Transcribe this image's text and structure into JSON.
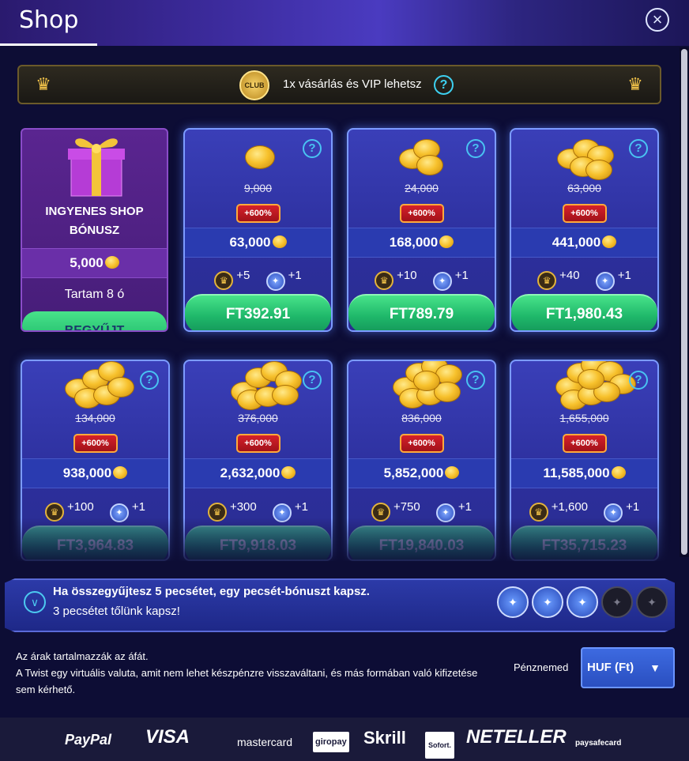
{
  "header": {
    "title": "Shop",
    "close_icon": "×"
  },
  "vip_banner": {
    "text": "1x vásárlás és VIP lehetsz",
    "club_label": "CLUB",
    "help": "?"
  },
  "free_card": {
    "title": "INGYENES SHOP BÓNUSZ",
    "amount": "5,000",
    "duration": "Tartam 8 ó",
    "button": "BEGYŰJT"
  },
  "offers": [
    {
      "old": "9,000",
      "pct": "+600%",
      "amount": "63,000",
      "crown": "+5",
      "seal": "+1",
      "price": "FT392.91"
    },
    {
      "old": "24,000",
      "pct": "+600%",
      "amount": "168,000",
      "crown": "+10",
      "seal": "+1",
      "price": "FT789.79"
    },
    {
      "old": "63,000",
      "pct": "+600%",
      "amount": "441,000",
      "crown": "+40",
      "seal": "+1",
      "price": "FT1,980.43"
    },
    {
      "old": "134,000",
      "pct": "+600%",
      "amount": "938,000",
      "crown": "+100",
      "seal": "+1",
      "price": "FT3,964.83"
    },
    {
      "old": "376,000",
      "pct": "+600%",
      "amount": "2,632,000",
      "crown": "+300",
      "seal": "+1",
      "price": "FT9,918.03"
    },
    {
      "old": "836,000",
      "pct": "+600%",
      "amount": "5,852,000",
      "crown": "+750",
      "seal": "+1",
      "price": "FT19,840.03"
    },
    {
      "old": "1,655,000",
      "pct": "+600%",
      "amount": "11,585,000",
      "crown": "+1,600",
      "seal": "+1",
      "price": "FT35,715.23"
    }
  ],
  "stamps": {
    "line1": "Ha összegyűjtesz 5 pecsétet, egy pecsét-bónuszt kapsz.",
    "line2": "3 pecsétet tőlünk kapsz!",
    "collected": 3,
    "total": 5
  },
  "info": {
    "line1": "Az árak tartalmazzák az áfát.",
    "line2": "A Twist egy virtuális valuta, amit nem lehet készpénzre visszaváltani, és más formában való kifizetése sem kérhető."
  },
  "currency": {
    "label": "Pénznemed",
    "value": "HUF (Ft)"
  },
  "payments": [
    "PayPal",
    "VISA",
    "mastercard",
    "giropay",
    "Skrill",
    "Sofort.",
    "NETELLER",
    "paysafecard"
  ],
  "colors": {
    "accent_green": "#1fb86a",
    "card_blue": "#2c2f9c",
    "gold": "#f7c12c"
  }
}
